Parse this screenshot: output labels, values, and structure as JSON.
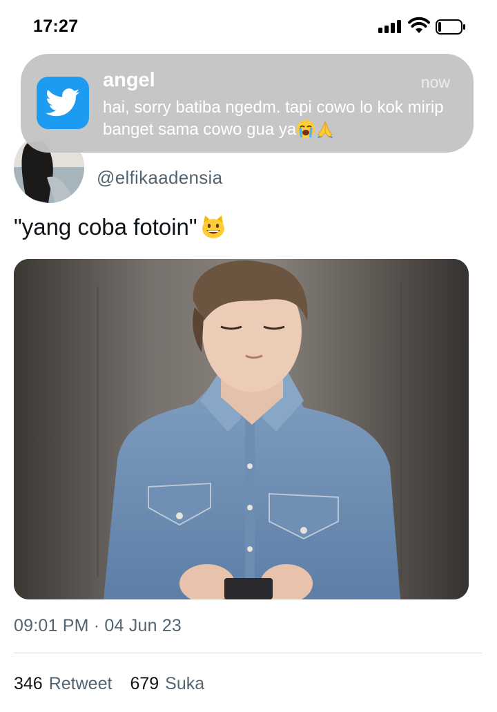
{
  "status_bar": {
    "time": "17:27",
    "icons": [
      "cellular-signal-icon",
      "wifi-icon",
      "battery-icon"
    ]
  },
  "notification": {
    "app_icon": "twitter-bird-icon",
    "sender": "angel",
    "time": "now",
    "message": "hai, sorry batiba ngedm. tapi cowo lo kok mirip banget sama cowo gua ya",
    "emojis": [
      "crying-face-emoji",
      "folded-hands-emoji"
    ]
  },
  "tweet": {
    "handle": "@elfikaadensia",
    "text": "\"yang coba fotoin\"",
    "text_emoji": "grinning-cat-emoji",
    "timestamp": "09:01 PM · 04 Jun 23",
    "stats": {
      "retweet_count": "346",
      "retweet_label": "Retweet",
      "like_count": "679",
      "like_label": "Suka"
    }
  },
  "colors": {
    "twitter_blue": "#1d9bf0",
    "secondary_text": "#536471",
    "notification_bg": "#c4c4c4"
  }
}
